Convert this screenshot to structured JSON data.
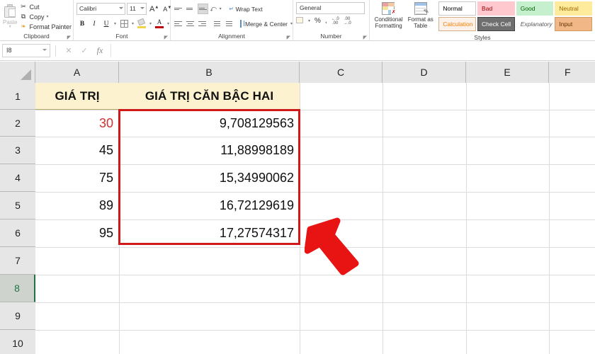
{
  "ribbon": {
    "clipboard": {
      "label": "Clipboard",
      "paste": "Paste",
      "cut": "Cut",
      "copy": "Copy",
      "format_painter": "Format Painter"
    },
    "font": {
      "label": "Font",
      "font_name": "Calibri",
      "font_size": "11",
      "bold": "B",
      "italic": "I",
      "underline": "U",
      "grow_font": "A",
      "shrink_font": "A"
    },
    "alignment": {
      "label": "Alignment",
      "wrap_text": "Wrap Text",
      "merge_center": "Merge & Center"
    },
    "number": {
      "label": "Number",
      "format": "General",
      "percent": "%",
      "comma": ","
    },
    "styles": {
      "label": "Styles",
      "conditional_formatting": "Conditional Formatting",
      "format_as_table": "Format as Table",
      "cells": [
        {
          "name": "Normal",
          "bg": "#ffffff",
          "fg": "#000000",
          "border": "#c9c9c9",
          "italic": false
        },
        {
          "name": "Bad",
          "bg": "#ffc7ce",
          "fg": "#9c0006",
          "border": "#ffc7ce",
          "italic": false
        },
        {
          "name": "Good",
          "bg": "#c6efce",
          "fg": "#006100",
          "border": "#c6efce",
          "italic": false
        },
        {
          "name": "Neutral",
          "bg": "#ffeb9c",
          "fg": "#9c6500",
          "border": "#ffeb9c",
          "italic": false
        },
        {
          "name": "Calculation",
          "bg": "#fdf2e9",
          "fg": "#fa7d00",
          "border": "#d6b08a",
          "italic": false
        },
        {
          "name": "Check Cell",
          "bg": "#6f6f6f",
          "fg": "#ffffff",
          "border": "#3f3f3f",
          "italic": false
        },
        {
          "name": "Explanatory ...",
          "bg": "#ffffff",
          "fg": "#5a5a5a",
          "border": "#ffffff",
          "italic": true
        },
        {
          "name": "Input",
          "bg": "#f2b787",
          "fg": "#5c2d00",
          "border": "#d6995f",
          "italic": false
        }
      ]
    }
  },
  "formula_bar": {
    "name_box": "I8",
    "formula": ""
  },
  "sheet": {
    "columns": [
      "A",
      "B",
      "C",
      "D",
      "E",
      "F"
    ],
    "rows": [
      "1",
      "2",
      "3",
      "4",
      "5",
      "6",
      "7",
      "8",
      "9",
      "10"
    ],
    "active_row": "8",
    "headers": {
      "a": "GIÁ TRỊ",
      "b": "GIÁ TRỊ CĂN BẬC HAI"
    },
    "data": [
      {
        "row": "2",
        "a": "30",
        "b": "9,708129563",
        "a_red": true
      },
      {
        "row": "3",
        "a": "45",
        "b": "11,88998189",
        "a_red": false
      },
      {
        "row": "4",
        "a": "75",
        "b": "15,34990062",
        "a_red": false
      },
      {
        "row": "5",
        "a": "89",
        "b": "16,72129619",
        "a_red": false
      },
      {
        "row": "6",
        "a": "95",
        "b": "17,27574317",
        "a_red": false
      }
    ]
  },
  "annotations": {
    "highlight_box_color": "#d01919",
    "arrow_color": "#e81313",
    "header_fill": "#fdf2cf",
    "excel_green": "#217346"
  }
}
